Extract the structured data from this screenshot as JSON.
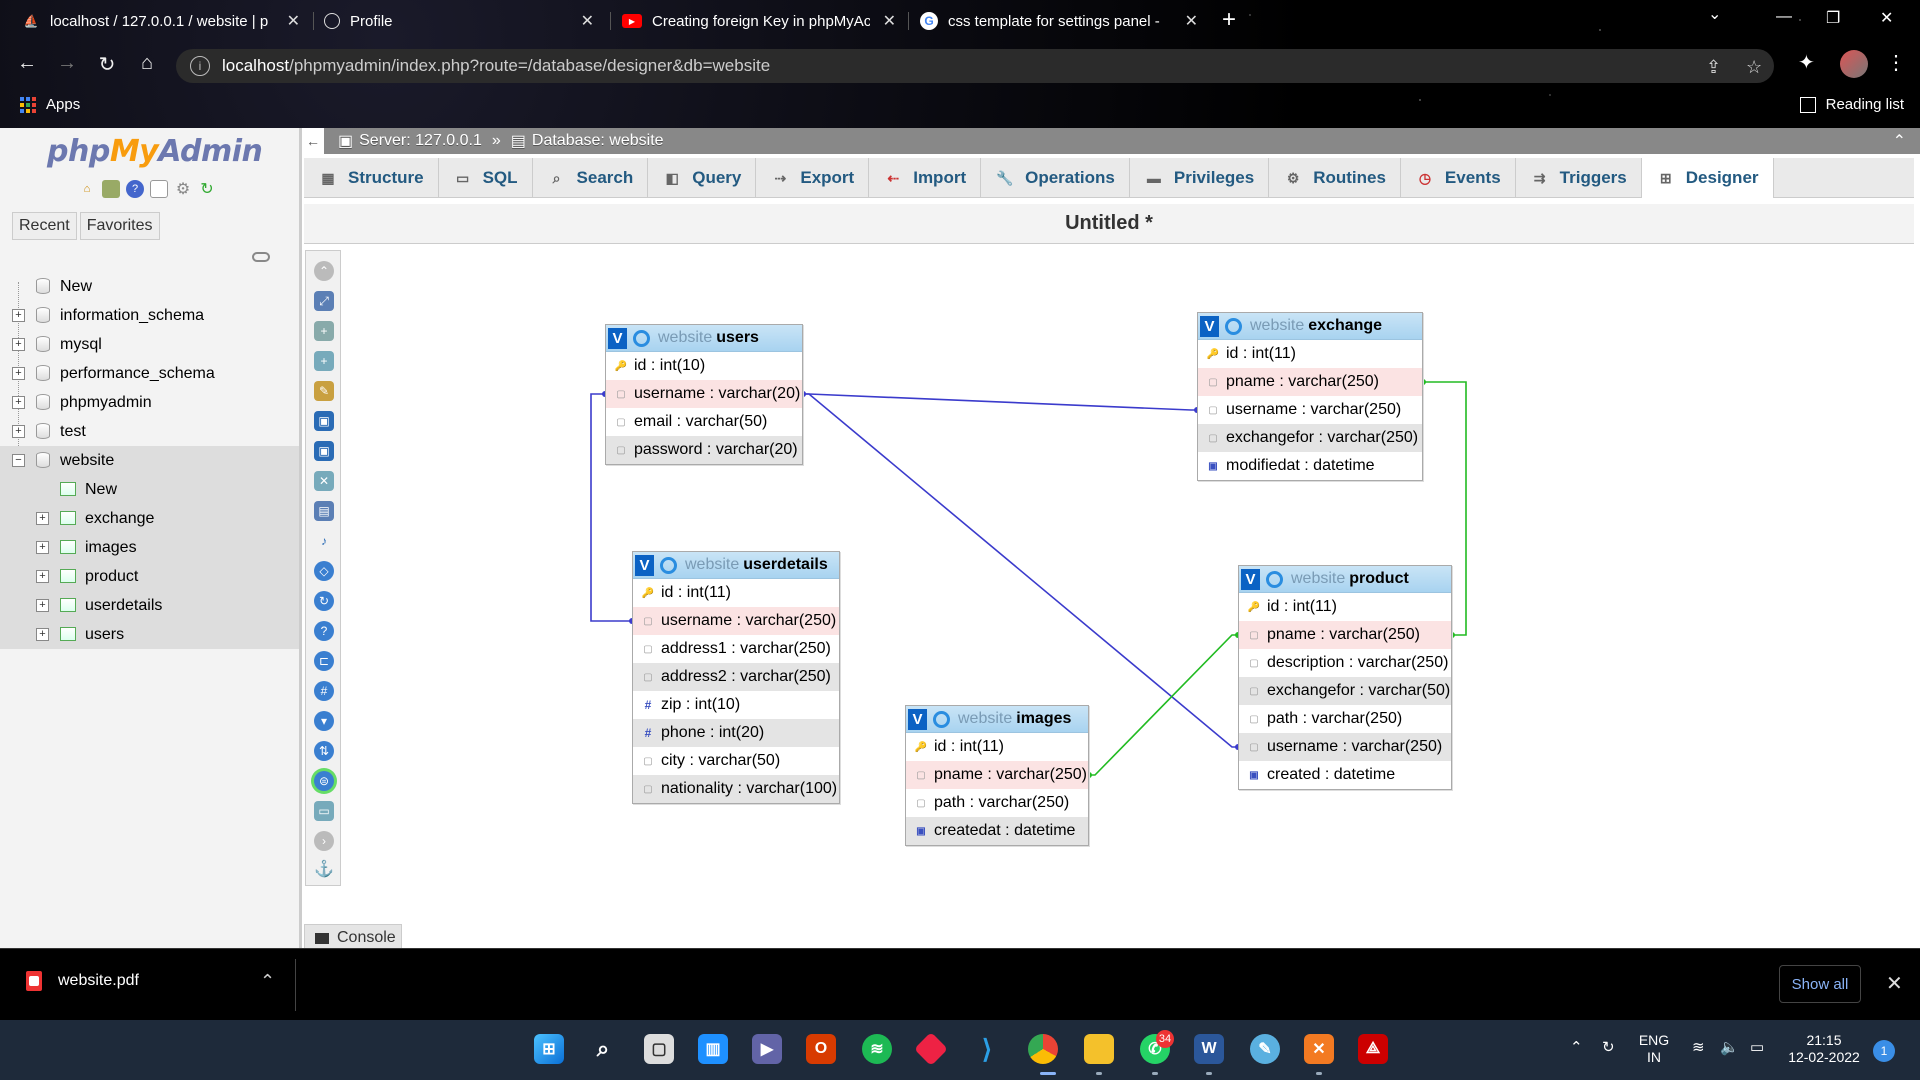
{
  "browser": {
    "tabs": [
      {
        "title": "localhost / 127.0.0.1 / website | p",
        "icon": "phpmyadmin-icon",
        "active": true
      },
      {
        "title": "Profile",
        "icon": "globe-icon",
        "active": false
      },
      {
        "title": "Creating foreign Key in phpMyAc",
        "icon": "youtube-icon",
        "active": false
      },
      {
        "title": "css template for settings panel -",
        "icon": "google-icon",
        "active": false
      }
    ],
    "url_host": "localhost",
    "url_path": "/phpmyadmin/index.php?route=/database/designer&db=website",
    "bookmarks": {
      "apps": "Apps",
      "reading_list": "Reading list"
    }
  },
  "pma": {
    "logo": {
      "php": "php",
      "my": "My",
      "admin": "Admin"
    },
    "nav_tabs": [
      "Recent",
      "Favorites"
    ],
    "tree": {
      "new": "New",
      "databases": [
        "information_schema",
        "mysql",
        "performance_schema",
        "phpmyadmin",
        "test",
        "website"
      ],
      "website_new": "New",
      "website_tables": [
        "exchange",
        "images",
        "product",
        "userdetails",
        "users"
      ]
    },
    "breadcrumb": {
      "server": "Server: 127.0.0.1",
      "sep": "»",
      "database": "Database: website"
    },
    "menu": [
      {
        "label": "Structure",
        "icon": "structure-icon"
      },
      {
        "label": "SQL",
        "icon": "sql-icon"
      },
      {
        "label": "Search",
        "icon": "search-icon"
      },
      {
        "label": "Query",
        "icon": "query-icon"
      },
      {
        "label": "Export",
        "icon": "export-icon"
      },
      {
        "label": "Import",
        "icon": "import-icon"
      },
      {
        "label": "Operations",
        "icon": "wrench-icon"
      },
      {
        "label": "Privileges",
        "icon": "privileges-icon"
      },
      {
        "label": "Routines",
        "icon": "routines-icon"
      },
      {
        "label": "Events",
        "icon": "clock-icon"
      },
      {
        "label": "Triggers",
        "icon": "triggers-icon"
      },
      {
        "label": "Designer",
        "icon": "designer-icon",
        "active": true
      }
    ],
    "designer": {
      "title": "Untitled *",
      "tables": {
        "users": {
          "db": "website",
          "name": "users",
          "columns": [
            {
              "name": "id",
              "type": "int(10)",
              "key": true
            },
            {
              "name": "username",
              "type": "varchar(20)",
              "hl": "pink"
            },
            {
              "name": "email",
              "type": "varchar(50)"
            },
            {
              "name": "password",
              "type": "varchar(20)",
              "hl": "gray"
            }
          ]
        },
        "exchange": {
          "db": "website",
          "name": "exchange",
          "columns": [
            {
              "name": "id",
              "type": "int(11)",
              "key": true
            },
            {
              "name": "pname",
              "type": "varchar(250)",
              "hl": "pink"
            },
            {
              "name": "username",
              "type": "varchar(250)"
            },
            {
              "name": "exchangefor",
              "type": "varchar(250)",
              "hl": "gray"
            },
            {
              "name": "modifiedat",
              "type": "datetime",
              "kind": "date"
            }
          ]
        },
        "userdetails": {
          "db": "website",
          "name": "userdetails",
          "columns": [
            {
              "name": "id",
              "type": "int(11)",
              "key": true
            },
            {
              "name": "username",
              "type": "varchar(250)",
              "hl": "pink"
            },
            {
              "name": "address1",
              "type": "varchar(250)"
            },
            {
              "name": "address2",
              "type": "varchar(250)",
              "hl": "gray"
            },
            {
              "name": "zip",
              "type": "int(10)",
              "kind": "num"
            },
            {
              "name": "phone",
              "type": "int(20)",
              "kind": "num",
              "hl": "gray"
            },
            {
              "name": "city",
              "type": "varchar(50)"
            },
            {
              "name": "nationality",
              "type": "varchar(100)",
              "hl": "gray"
            }
          ]
        },
        "product": {
          "db": "website",
          "name": "product",
          "columns": [
            {
              "name": "id",
              "type": "int(11)",
              "key": true
            },
            {
              "name": "pname",
              "type": "varchar(250)",
              "hl": "pink"
            },
            {
              "name": "description",
              "type": "varchar(250)"
            },
            {
              "name": "exchangefor",
              "type": "varchar(50)",
              "hl": "gray"
            },
            {
              "name": "path",
              "type": "varchar(250)"
            },
            {
              "name": "username",
              "type": "varchar(250)",
              "hl": "gray"
            },
            {
              "name": "created",
              "type": "datetime",
              "kind": "date"
            }
          ]
        },
        "images": {
          "db": "website",
          "name": "images",
          "columns": [
            {
              "name": "id",
              "type": "int(11)",
              "key": true
            },
            {
              "name": "pname",
              "type": "varchar(250)",
              "hl": "pink"
            },
            {
              "name": "path",
              "type": "varchar(250)"
            },
            {
              "name": "createdat",
              "type": "datetime",
              "kind": "date",
              "hl": "gray"
            }
          ]
        }
      },
      "relations": [
        {
          "from": "users.username",
          "to": "exchange.username",
          "color": "#3b3bcc"
        },
        {
          "from": "users.username",
          "to": "userdetails.username",
          "color": "#3b3bcc"
        },
        {
          "from": "users.username",
          "to": "product.username",
          "color": "#3b3bcc"
        },
        {
          "from": "product.pname",
          "to": "exchange.pname",
          "color": "#22bb22"
        },
        {
          "from": "images.pname",
          "to": "product.pname",
          "color": "#22bb22"
        }
      ]
    },
    "console": "Console"
  },
  "downloads": {
    "file": "website.pdf",
    "show_all": "Show all"
  },
  "taskbar": {
    "lang": "ENG",
    "region": "IN",
    "time": "21:15",
    "date": "12-02-2022",
    "whatsapp_badge": "34",
    "notifications": "1"
  }
}
